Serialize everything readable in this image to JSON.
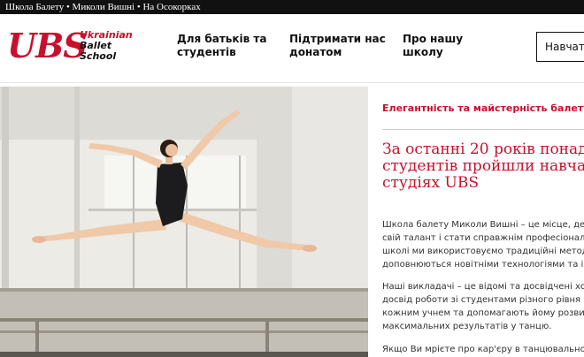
{
  "topbar": {
    "text": "Школа Балету • Миколи Вишні • На Осокорках"
  },
  "logo": {
    "mark": "UBS",
    "line1": "Ukrainian",
    "line2": "Ballet",
    "line3": "School"
  },
  "nav": [
    {
      "line1": "Для батьків та",
      "line2": "студентів"
    },
    {
      "line1": "Підтримати нас",
      "line2": "донатом"
    },
    {
      "line1": "Про нашу",
      "line2": "школу"
    }
  ],
  "cta": {
    "label": "Навчатися"
  },
  "hero": {
    "alt": "photo-dancer-split-leap"
  },
  "content": {
    "tagline": "Елегантність та майстерність балету у",
    "headline": [
      "За останні 20 років понад",
      "студентів пройшли навчання",
      "студіях UBS"
    ],
    "paragraph1": [
      "Школа балету Миколи Вишні – це місце, де кожен",
      "свій талант і стати справжнім професіоналом.",
      "школі ми використовуємо традиційні методики",
      "доповнюються новітніми технологіями та інно"
    ],
    "paragraph2": [
      "Наші викладачі – це відомі та досвідчені хоре",
      "досвід роботи зі студентами різного рівня під",
      "кожним учнем та допомагають йому розвива",
      "максимальних результатів у танцю."
    ],
    "paragraph3": [
      "Якщо Ви мрієте про кар'єру в танцювальному"
    ]
  },
  "colors": {
    "accent": "#c8102e",
    "topbar_bg": "#111111",
    "text": "#111111"
  }
}
